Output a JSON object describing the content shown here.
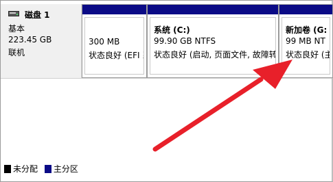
{
  "disk": {
    "name": "磁盘 1",
    "type": "基本",
    "size": "223.45 GB",
    "status": "联机"
  },
  "partitions": [
    {
      "title": "",
      "size": "300 MB",
      "status": "状态良好 (EFI 系"
    },
    {
      "title": "系统 (C:)",
      "size": "99.90 GB NTFS",
      "status": "状态良好 (启动, 页面文件, 故障转"
    },
    {
      "title": "新加卷 (G:",
      "size": "99 MB NT",
      "status": "状态良好 (主"
    }
  ],
  "legend": {
    "unallocated": {
      "label": "未分配",
      "color": "#000000"
    },
    "primary": {
      "label": "主分区",
      "color": "#0b0b86"
    }
  },
  "colors": {
    "partition_bar": "#0b0b86",
    "annotation_arrow": "#e8202a"
  }
}
